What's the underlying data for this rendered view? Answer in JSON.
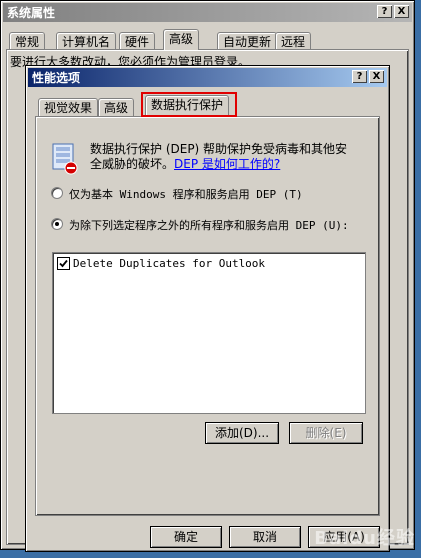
{
  "back_window": {
    "title": "系统属性",
    "tabs": [
      "常规",
      "计算机名",
      "硬件",
      "高级",
      "自动更新",
      "远程"
    ],
    "active_tab": "高级",
    "partial_text": "要进行大多数改动，您必须作为管理员登录。"
  },
  "dialog": {
    "title": "性能选项",
    "title_buttons": [
      "?",
      "X"
    ],
    "tabs": [
      "视觉效果",
      "高级",
      "数据执行保护"
    ],
    "active_tab": "数据执行保护",
    "description_line1": "数据执行保护 (DEP) 帮助保护免受病毒和其他安",
    "description_line2": "全威胁的破坏。",
    "help_link": "DEP 是如何工作的?",
    "radio_option1": "仅为基本 Windows 程序和服务启用 DEP (T)",
    "radio_option2": "为除下列选定程序之外的所有程序和服务启用 DEP (U):",
    "selected_option": 2,
    "programs": [
      {
        "name": "Delete Duplicates for Outlook",
        "checked": true
      }
    ],
    "add_button": "添加(D)...",
    "remove_button": "删除(E)",
    "ok_button": "确定",
    "cancel_button": "取消",
    "apply_button": "应用(A)"
  },
  "highlight_color": "#e00000",
  "watermark": "Baidu经验"
}
